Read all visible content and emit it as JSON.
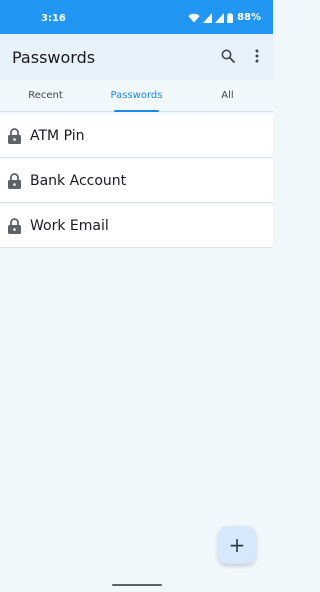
{
  "status_bar": {
    "time": "3:16",
    "battery": "88%"
  },
  "app_bar": {
    "title": "Passwords"
  },
  "tabs": [
    {
      "label": "Recent",
      "active": false
    },
    {
      "label": "Passwords",
      "active": true
    },
    {
      "label": "All",
      "active": false
    }
  ],
  "items": [
    {
      "label": "ATM Pin",
      "icon": "lock-icon"
    },
    {
      "label": "Bank Account",
      "icon": "lock-icon"
    },
    {
      "label": "Work Email",
      "icon": "lock-icon"
    }
  ],
  "fab": {
    "label": "+"
  },
  "colors": {
    "status_bar": "#2196f3",
    "app_bar": "#e8f2fd",
    "accent": "#1e88e5",
    "background": "#f1f8fc"
  }
}
